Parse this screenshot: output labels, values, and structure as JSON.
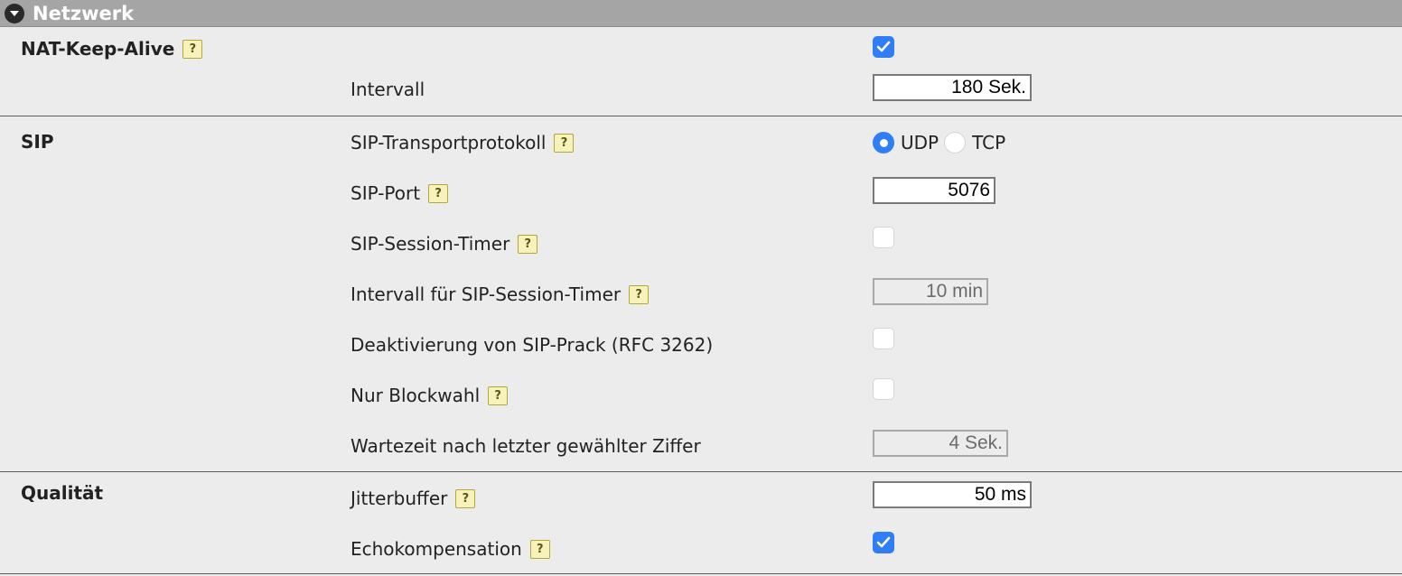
{
  "panel": {
    "title": "Netzwerk",
    "toggle_icon": "chevron-down-icon"
  },
  "colors": {
    "header_bg": "#a5a5a5",
    "body_bg": "#ececec",
    "accent": "#2f7ef6",
    "help_bg": "#f6f2b9"
  },
  "help_glyph": "?",
  "nat": {
    "section_label": "NAT-Keep-Alive",
    "enabled": true,
    "interval_label": "Intervall",
    "interval_value": "180 Sek."
  },
  "sip": {
    "section_label": "SIP",
    "transport_label": "SIP-Transportprotokoll",
    "transport_options": [
      "UDP",
      "TCP"
    ],
    "transport_selected": "UDP",
    "port_label": "SIP-Port",
    "port_value": "5076",
    "session_timer_label": "SIP-Session-Timer",
    "session_timer_enabled": false,
    "session_timer_interval_label": "Intervall für SIP-Session-Timer",
    "session_timer_interval_value": "10 min",
    "prack_label": "Deaktivierung von SIP-Prack (RFC 3262)",
    "prack_enabled": false,
    "block_dial_label": "Nur Blockwahl",
    "block_dial_enabled": false,
    "wait_label": "Wartezeit nach letzter gewählter Ziffer",
    "wait_value": "4 Sek."
  },
  "quality": {
    "section_label": "Qualität",
    "jitter_label": "Jitterbuffer",
    "jitter_value": "50 ms",
    "echo_label": "Echokompensation",
    "echo_enabled": true
  }
}
